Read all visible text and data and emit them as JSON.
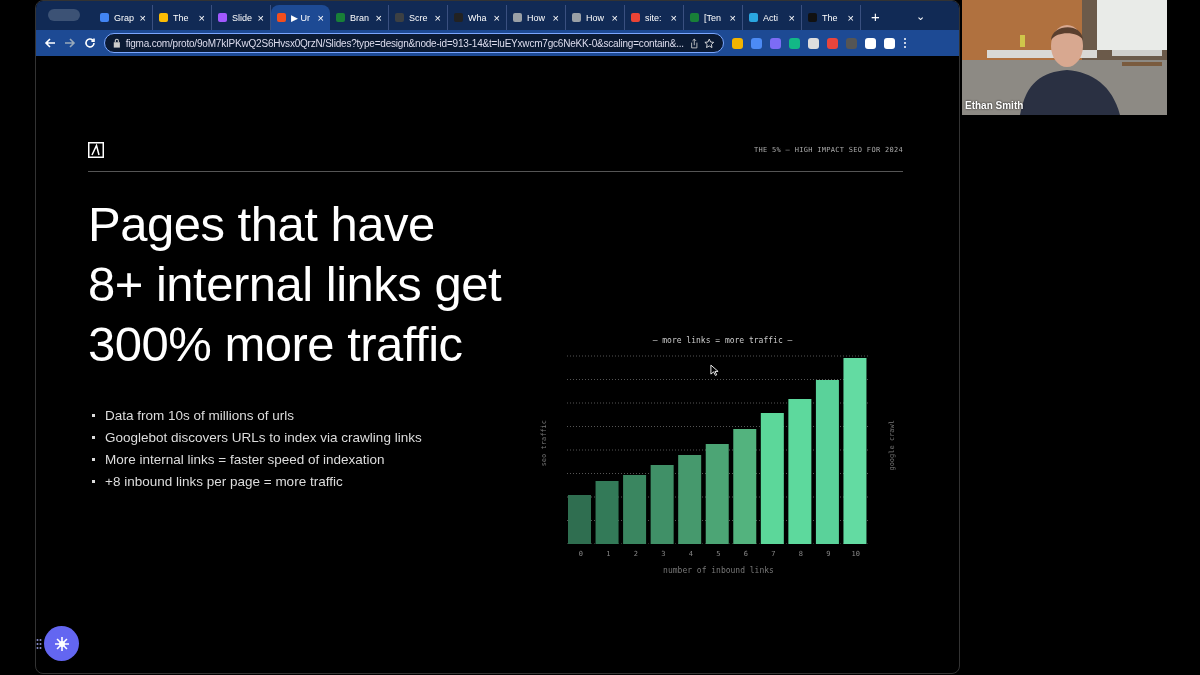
{
  "browser": {
    "tabs": [
      {
        "label": "Grap",
        "selected": false
      },
      {
        "label": "The",
        "selected": false
      },
      {
        "label": "Slide",
        "selected": false
      },
      {
        "label": "▶ Ur",
        "selected": true
      },
      {
        "label": "Bran",
        "selected": false
      },
      {
        "label": "Scre",
        "selected": false
      },
      {
        "label": "Wha",
        "selected": false
      },
      {
        "label": "How",
        "selected": false
      },
      {
        "label": "How",
        "selected": false
      },
      {
        "label": "site:",
        "selected": false
      },
      {
        "label": "[Ten",
        "selected": false
      },
      {
        "label": "Acti",
        "selected": false
      },
      {
        "label": "The",
        "selected": false
      }
    ],
    "new_tab": "+",
    "tab_menu": "⌄",
    "close_glyph": "×",
    "url": "figma.com/proto/9oM7kIPKwQ2S6Hvsx0QrzN/Slides?type=design&node-id=913-14&t=luEYxwcm7gc6NeKK-0&scaling=contain&..."
  },
  "slide": {
    "header": "THE 5% — HIGH IMPACT SEO FOR 2024",
    "title_lines": [
      "Pages that have",
      "8+ internal links get",
      "300% more traffic"
    ],
    "bullets": [
      "Data from 10s of millions of urls",
      "Googlebot discovers URLs to index via crawling links",
      "More internal links = faster speed of indexation",
      "+8 inbound links per page = more traffic"
    ],
    "chart": {
      "title": "— more links = more traffic —",
      "ylabel": "seo traffic",
      "ylabel_right": "google crawl",
      "xlabel": "number of inbound links",
      "categories": [
        "0",
        "1",
        "2",
        "3",
        "4",
        "5",
        "6",
        "7",
        "8",
        "9",
        "10"
      ]
    }
  },
  "video": {
    "name": "Ethan Smith"
  }
}
